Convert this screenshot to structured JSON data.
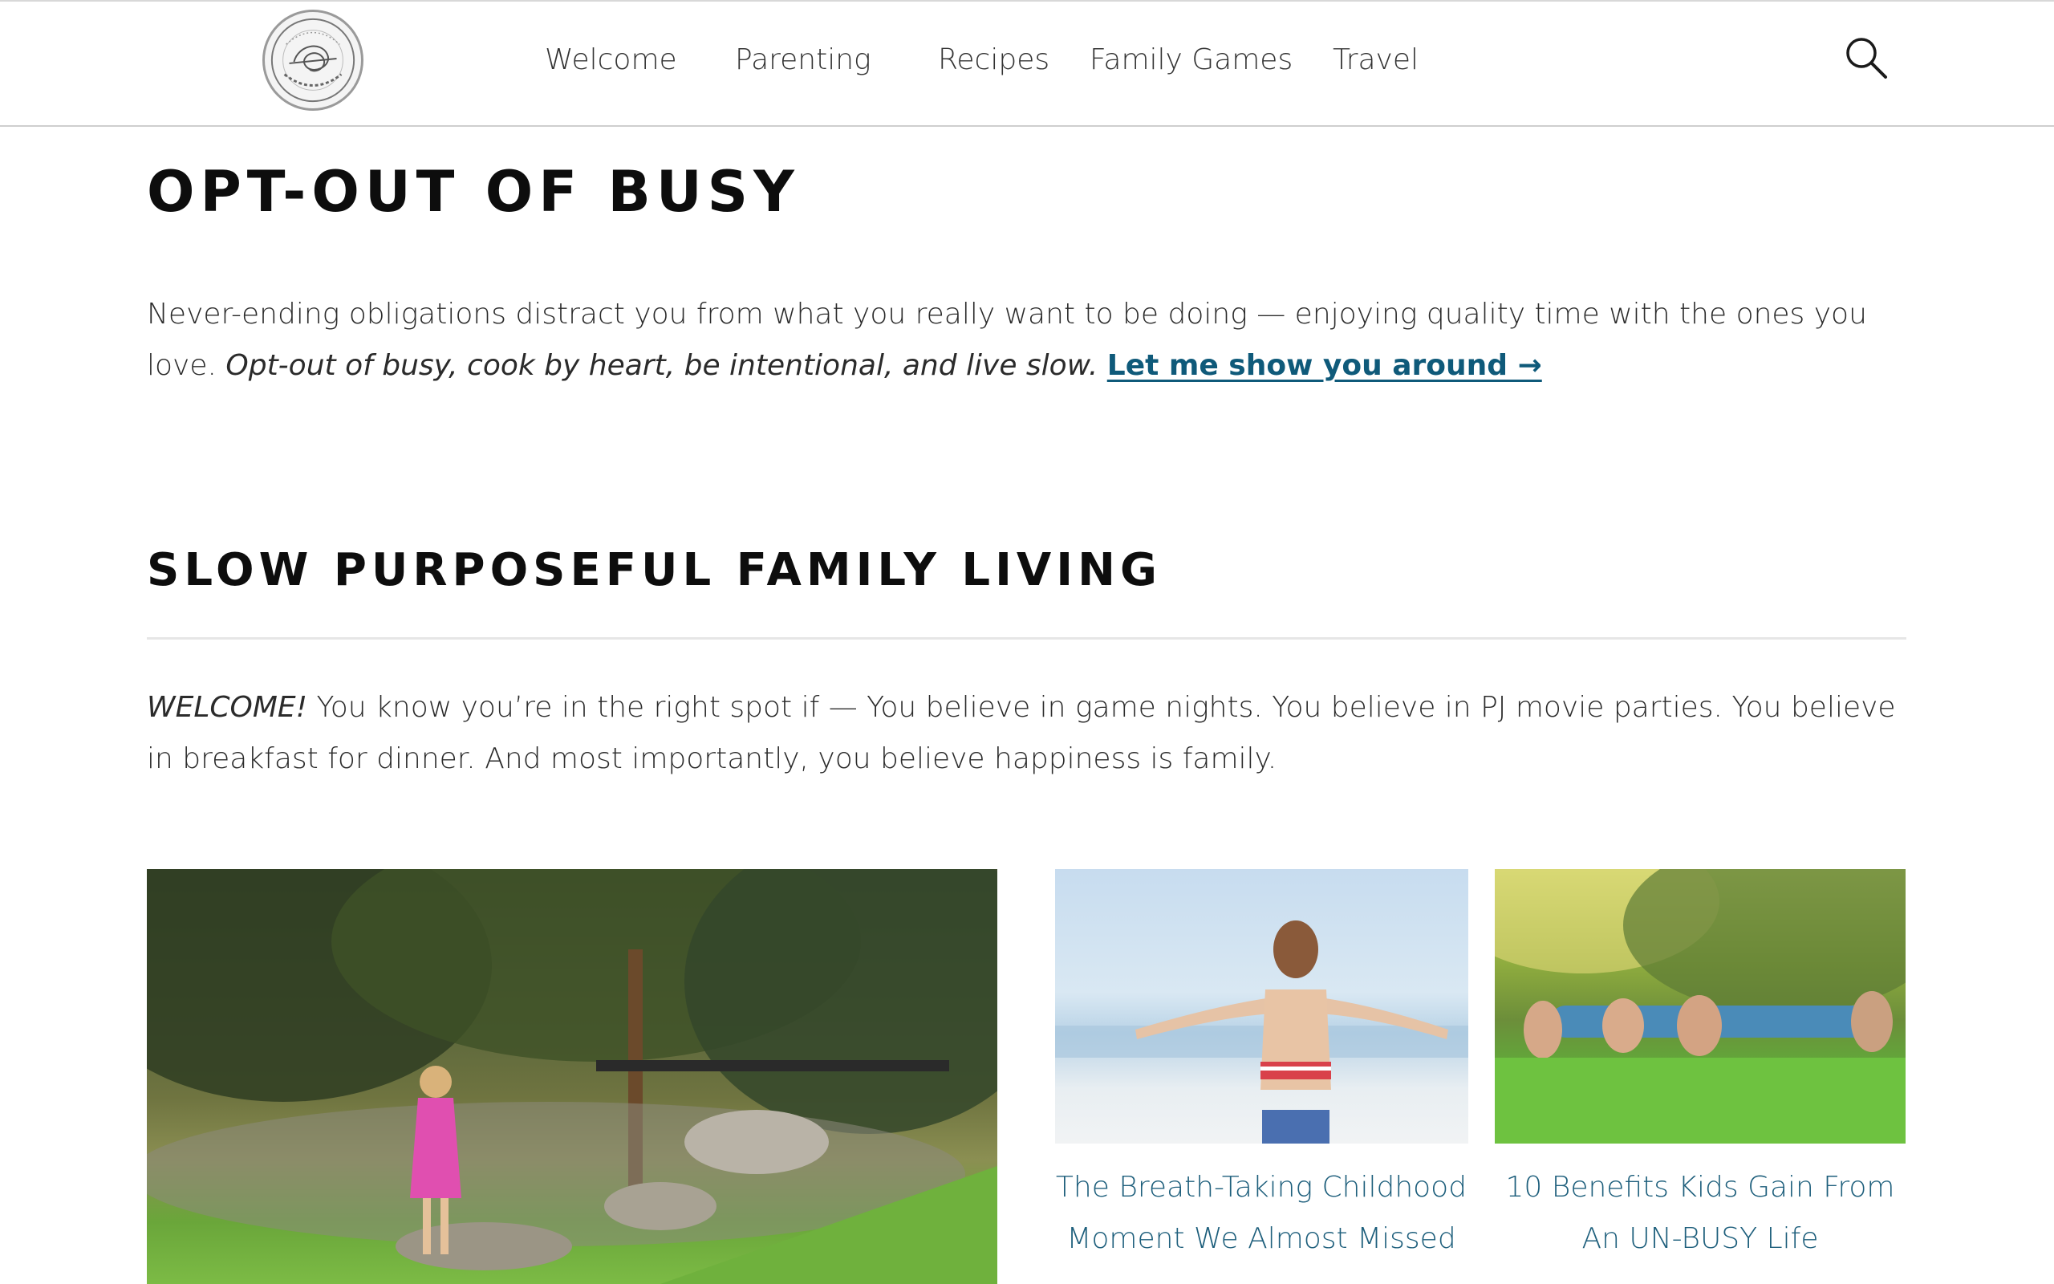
{
  "header": {
    "logo_alt": "Simplifying Life",
    "nav": [
      {
        "label": "Welcome"
      },
      {
        "label": "Parenting"
      },
      {
        "label": "Recipes"
      },
      {
        "label": "Family Games"
      },
      {
        "label": "Travel"
      }
    ],
    "search_icon": "search-icon"
  },
  "hero": {
    "title": "OPT-OUT OF BUSY",
    "intro_text": "Never-ending obligations distract you from what you really want to be doing — enjoying quality time with the ones you love. ",
    "intro_italic": "Opt-out of busy, cook by heart, be intentional, and live slow.",
    "intro_link": "Let me show you around →"
  },
  "section": {
    "title": "SLOW PURPOSEFUL FAMILY LIVING",
    "welcome_italic": "WELCOME!",
    "welcome_text": " You know you’re in the right spot if — You believe in game nights. You believe in PJ movie parties. You believe in breakfast for dinner. And most importantly, you believe happiness is family."
  },
  "posts": [
    {
      "title": ""
    },
    {
      "title": "The Breath-Taking Childhood Moment We Almost Missed"
    },
    {
      "title": "10 Benefits Kids Gain From An UN-BUSY Life"
    }
  ],
  "colors": {
    "link": "#0f5a7a",
    "post_title": "#1e5f7c",
    "heading": "#0d0d0d",
    "body_text": "#2b2b2b"
  }
}
